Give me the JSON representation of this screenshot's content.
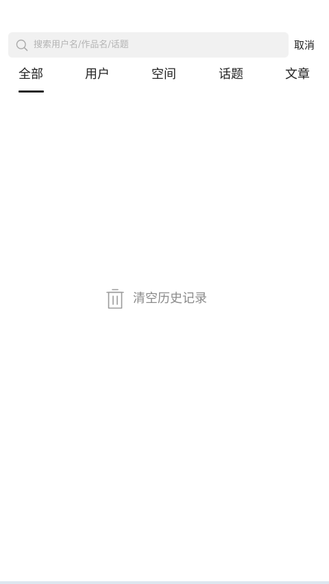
{
  "search": {
    "placeholder": "搜索用户名/作品名/话题",
    "value": "",
    "icon": "search-icon"
  },
  "cancel_label": "取消",
  "tabs": [
    {
      "label": "全部",
      "active": true
    },
    {
      "label": "用户",
      "active": false
    },
    {
      "label": "空间",
      "active": false
    },
    {
      "label": "话题",
      "active": false
    },
    {
      "label": "文章",
      "active": false
    }
  ],
  "history": {
    "clear_label": "清空历史记录",
    "icon": "trash-icon"
  },
  "colors": {
    "search_background": "#f1f1f1",
    "placeholder": "#b4b4b4",
    "text": "#222222",
    "muted": "#8a8a8a",
    "active_underline": "#1f1f1f"
  }
}
